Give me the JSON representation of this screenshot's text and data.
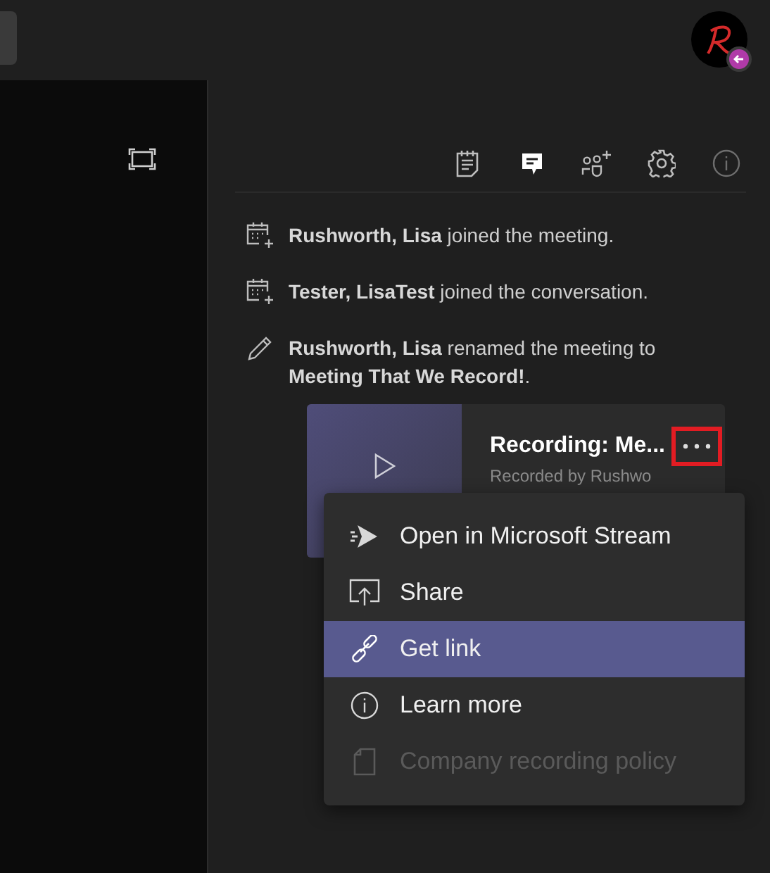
{
  "toolbar": {
    "items": [
      {
        "kind": "notes",
        "selected": false
      },
      {
        "kind": "chat",
        "selected": true
      },
      {
        "kind": "people",
        "selected": false
      },
      {
        "kind": "settings",
        "selected": false
      },
      {
        "kind": "info",
        "selected": false
      }
    ]
  },
  "messages": [
    {
      "kind": "joined",
      "text": "**Rushworth, Lisa** joined the meeting."
    },
    {
      "kind": "joined",
      "text": "**Tester, LisaTest** joined the conversation."
    },
    {
      "kind": "renamed",
      "text": "**Rushworth, Lisa** renamed the meeting to **Meeting That We Record!**."
    }
  ],
  "recording_card": {
    "title": "Recording: Me...",
    "subtitle": "Recorded by Rushwo"
  },
  "context_menu": {
    "items": [
      {
        "kind": "stream",
        "label": "Open in Microsoft Stream",
        "selected": false,
        "disabled": false
      },
      {
        "kind": "share",
        "label": "Share",
        "selected": false,
        "disabled": false
      },
      {
        "kind": "link",
        "label": "Get link",
        "selected": true,
        "disabled": false
      },
      {
        "kind": "info",
        "label": "Learn more",
        "selected": false,
        "disabled": false
      },
      {
        "kind": "policy",
        "label": "Company recording policy",
        "selected": false,
        "disabled": true
      }
    ]
  }
}
